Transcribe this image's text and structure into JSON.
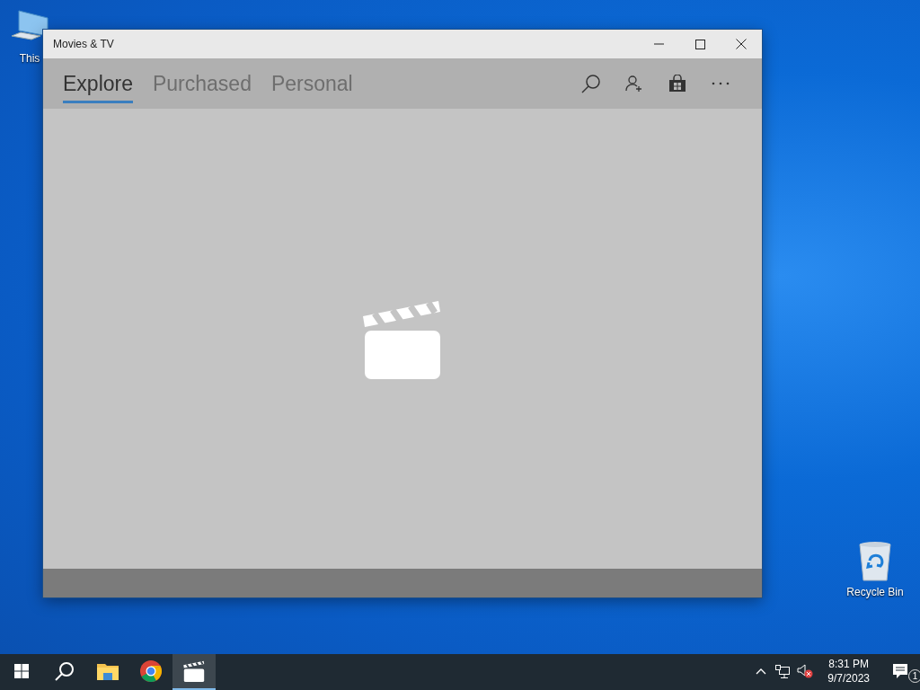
{
  "desktop_icons": [
    {
      "label": "This",
      "kind": "pc"
    },
    {
      "label": "Recycle Bin",
      "kind": "bin"
    }
  ],
  "window": {
    "title": "Movies & TV",
    "tabs": [
      {
        "label": "Explore",
        "selected": true
      },
      {
        "label": "Purchased",
        "selected": false
      },
      {
        "label": "Personal",
        "selected": false
      }
    ]
  },
  "taskbar": {
    "apps": [
      {
        "kind": "explorer",
        "active": false
      },
      {
        "kind": "chrome",
        "active": false
      },
      {
        "kind": "movies",
        "active": true
      }
    ],
    "volume_muted": true,
    "time": "8:31 PM",
    "date": "9/7/2023",
    "notifications": "1"
  }
}
